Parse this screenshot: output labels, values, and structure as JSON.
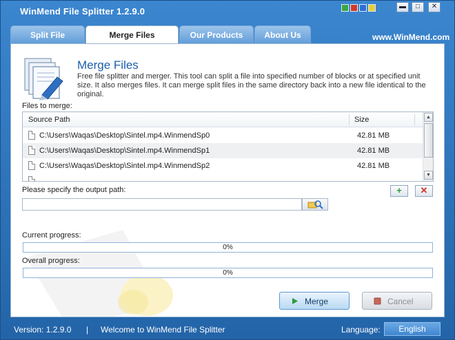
{
  "window": {
    "title": "WinMend File Splitter 1.2.9.0",
    "colors": [
      "#3aa641",
      "#d23a2a",
      "#2f6fcf",
      "#e8cf3a"
    ],
    "min_label": "▬",
    "max_label": "□",
    "close_label": "✕"
  },
  "tabs": [
    {
      "label": "Split File",
      "active": false
    },
    {
      "label": "Merge Files",
      "active": true
    },
    {
      "label": "Our Products",
      "active": false
    },
    {
      "label": "About Us",
      "active": false
    }
  ],
  "site_link": "www.WinMend.com",
  "header": {
    "title": "Merge Files",
    "description": "Free file splitter and merger. This tool can split a file into specified number of blocks or at specified unit size. It also merges files. It can merge split files in the same directory back into a new file identical to the original."
  },
  "files": {
    "label": "Files to merge:",
    "columns": [
      "Source Path",
      "Size"
    ],
    "rows": [
      {
        "path": "C:\\Users\\Waqas\\Desktop\\Sintel.mp4.WinmendSp0",
        "size": "42.81 MB"
      },
      {
        "path": "C:\\Users\\Waqas\\Desktop\\Sintel.mp4.WinmendSp1",
        "size": "42.81 MB"
      },
      {
        "path": "C:\\Users\\Waqas\\Desktop\\Sintel.mp4.WinmendSp2",
        "size": "42.81 MB"
      }
    ],
    "add_icon": "add-file-icon",
    "remove_icon": "remove-file-icon"
  },
  "output": {
    "label": "Please specify the output path:",
    "value": "",
    "browse_icon": "browse-folder-icon"
  },
  "progress": {
    "current_label": "Current progress:",
    "current_value": "0%",
    "current_fraction": 0,
    "overall_label": "Overall progress:",
    "overall_value": "0%",
    "overall_fraction": 0
  },
  "actions": {
    "merge_label": "Merge",
    "cancel_label": "Cancel"
  },
  "status": {
    "version": "Version:  1.2.9.0",
    "separator": "|",
    "welcome": "Welcome to WinMend File Splitter",
    "language_label": "Language:",
    "language_value": "English"
  }
}
